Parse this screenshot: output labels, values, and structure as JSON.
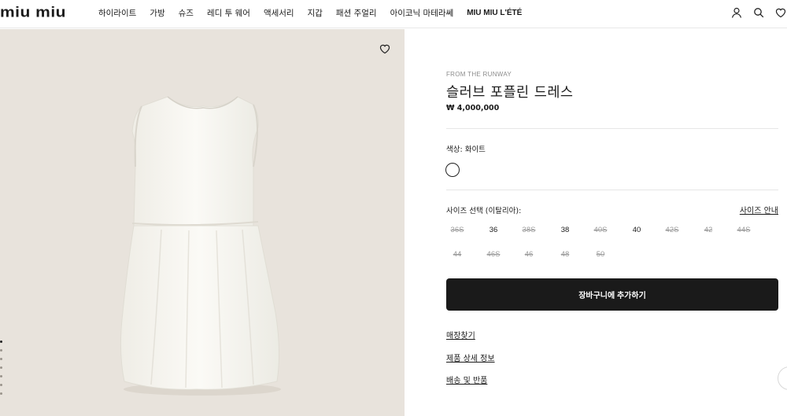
{
  "header": {
    "logo": "miu miu",
    "nav": [
      {
        "label": "하이라이트"
      },
      {
        "label": "가방"
      },
      {
        "label": "슈즈"
      },
      {
        "label": "레디 투 웨어"
      },
      {
        "label": "액세서리"
      },
      {
        "label": "지갑"
      },
      {
        "label": "패션 주얼리"
      },
      {
        "label": "아이코닉 마테라쎄"
      },
      {
        "label": "MIU MIU L'ÉTÉ"
      }
    ],
    "icons": [
      "user-icon",
      "search-icon",
      "heart-icon"
    ]
  },
  "gallery": {
    "image": "white sleeveless poplin dress",
    "slide_count": 7,
    "active_slide": 1,
    "background": "#e8e3dc"
  },
  "product": {
    "eyebrow": "FROM THE RUNWAY",
    "title": "슬러브 포플린 드레스",
    "price": "₩ 4,000,000",
    "color_label": "색상:  화이트",
    "color_swatch": "#ffffff",
    "size_label": "사이즈 선택 (이탈리아):",
    "size_guide": "사이즈 안내",
    "sizes": [
      {
        "label": "36S",
        "available": false
      },
      {
        "label": "36",
        "available": true
      },
      {
        "label": "38S",
        "available": false
      },
      {
        "label": "38",
        "available": true
      },
      {
        "label": "40S",
        "available": false
      },
      {
        "label": "40",
        "available": true
      },
      {
        "label": "42S",
        "available": false
      },
      {
        "label": "42",
        "available": false
      },
      {
        "label": "44S",
        "available": false
      },
      {
        "label": "44",
        "available": false
      },
      {
        "label": "46S",
        "available": false
      },
      {
        "label": "46",
        "available": false
      },
      {
        "label": "48",
        "available": false
      },
      {
        "label": "50",
        "available": false
      }
    ],
    "cart_button": "장바구니에 추가하기",
    "links": [
      "매장찾기",
      "제품 상세 정보",
      "배송 및 반품"
    ]
  }
}
